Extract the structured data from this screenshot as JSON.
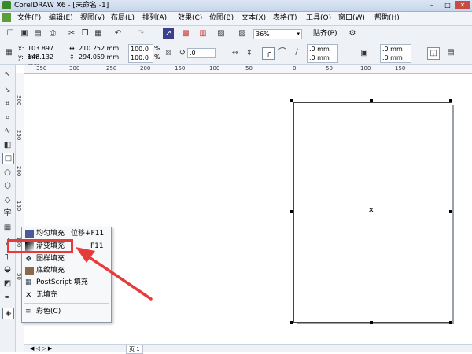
{
  "titlebar": {
    "title": "CorelDRAW X6 - [未命名 -1]"
  },
  "menu": {
    "items": [
      "文件(F)",
      "编辑(E)",
      "视图(V)",
      "布局(L)",
      "排列(A)",
      "效果(C)",
      "位图(B)",
      "文本(X)",
      "表格(T)",
      "工具(O)",
      "窗口(W)",
      "帮助(H)"
    ]
  },
  "toolbar": {
    "zoom": "36%",
    "snap": "贴齐(P)"
  },
  "property_bar": {
    "x": "103.897 mm",
    "y": "148.132 mm",
    "width": "210.252 mm",
    "height": "294.059 mm",
    "scale_x": "100.0",
    "scale_y": "100.0",
    "pct": "%",
    "rotation": ".0",
    "corner_a": ".0 mm",
    "corner_b": ".0 mm",
    "corner_c": ".0 mm",
    "corner_d": ".0 mm",
    "x_label": "x:",
    "y_label": "y:"
  },
  "ruler": {
    "h_ticks": [
      "350",
      "300",
      "250",
      "200",
      "150",
      "100",
      "50",
      "0",
      "50",
      "100",
      "150"
    ],
    "v_ticks": [
      "300",
      "250",
      "200",
      "150",
      "100",
      "50"
    ]
  },
  "flyout": {
    "items": [
      {
        "label": "均匀填充",
        "shortcut": "位移+F11"
      },
      {
        "label": "渐变填充",
        "shortcut": "F11"
      },
      {
        "label": "图样填充",
        "shortcut": ""
      },
      {
        "label": "底纹填充",
        "shortcut": ""
      },
      {
        "label": "PostScript 填充",
        "shortcut": ""
      },
      {
        "label": "无填充",
        "shortcut": ""
      },
      {
        "label": "彩色(C)",
        "shortcut": ""
      }
    ]
  },
  "status": {
    "page": "页 1"
  },
  "colors": {
    "accent_red": "#e63b3b"
  }
}
